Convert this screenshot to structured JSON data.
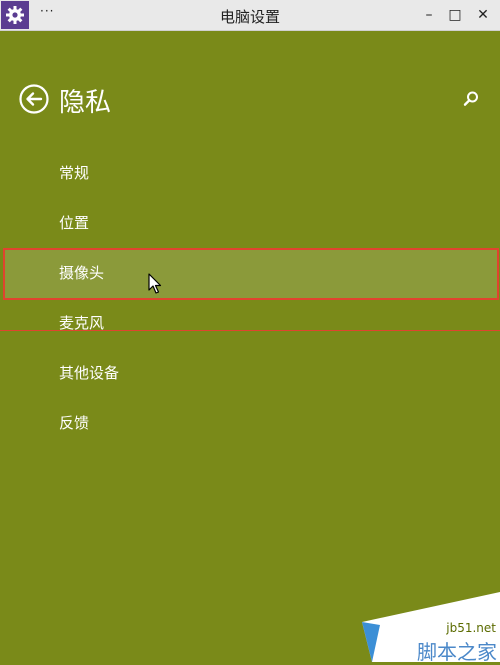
{
  "window": {
    "title": "电脑设置",
    "menu_glyph": "···",
    "minimize_glyph": "–",
    "maximize_glyph": "□",
    "close_glyph": "✕",
    "app_icon": "gear-icon"
  },
  "page": {
    "title": "隐私",
    "back_icon": "back-arrow-icon",
    "search_icon": "search-icon"
  },
  "nav": {
    "items": [
      {
        "label": "常规",
        "selected": false
      },
      {
        "label": "位置",
        "selected": false
      },
      {
        "label": "摄像头",
        "selected": true
      },
      {
        "label": "麦克风",
        "selected": false
      },
      {
        "label": "其他设备",
        "selected": false
      },
      {
        "label": "反馈",
        "selected": false
      }
    ]
  },
  "watermark": {
    "domain": "jb51.net",
    "text": "脚本之家"
  },
  "colors": {
    "background": "#7a8a19",
    "selected_bg": "#8b9a3a",
    "highlight_border": "#e0442f",
    "app_icon_bg": "#5b3d91"
  }
}
